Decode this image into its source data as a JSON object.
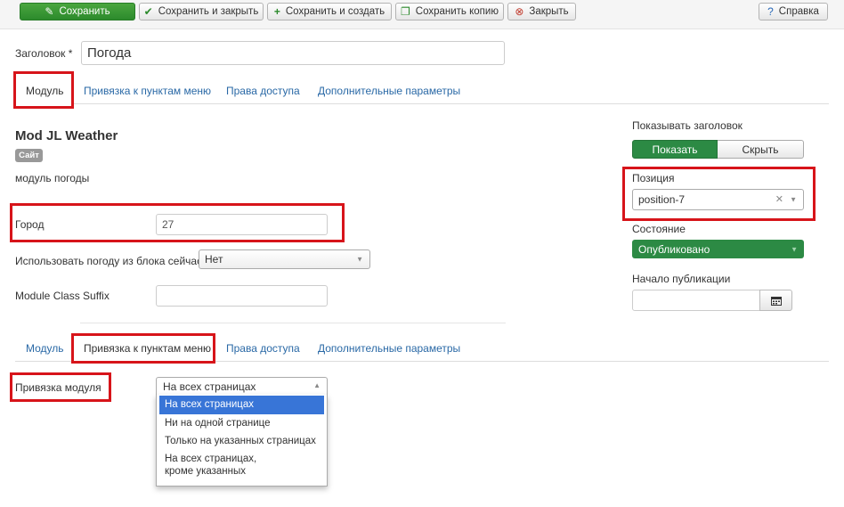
{
  "toolbar": {
    "save": "Сохранить",
    "save_close": "Сохранить и закрыть",
    "save_new": "Сохранить и создать",
    "save_copy": "Сохранить копию",
    "close": "Закрыть",
    "help": "Справка"
  },
  "title_field": {
    "label": "Заголовок *",
    "value": "Погода"
  },
  "tabs": {
    "module": "Модуль",
    "menu_assignment": "Привязка к пунктам меню",
    "permissions": "Права доступа",
    "advanced": "Дополнительные параметры"
  },
  "module": {
    "name": "Mod JL Weather",
    "badge": "Сайт",
    "description": "модуль погоды"
  },
  "fields": {
    "city_label": "Город",
    "city_value": "27",
    "use_weather_label": "Использовать погоду из блока сейчас",
    "use_weather_value": "Нет",
    "suffix_label": "Module Class Suffix",
    "suffix_value": ""
  },
  "right": {
    "show_title_label": "Показывать заголовок",
    "show": "Показать",
    "hide": "Скрыть",
    "position_label": "Позиция",
    "position_value": "position-7",
    "status_label": "Состояние",
    "status_value": "Опубликовано",
    "publish_up_label": "Начало публикации",
    "publish_up_value": ""
  },
  "assignment": {
    "label": "Привязка модуля",
    "selected": "На всех страницах",
    "options": [
      "На всех страницах",
      "Ни на одной странице",
      "Только на указанных страницах",
      "На всех страницах, кроме указанных"
    ]
  },
  "colors": {
    "success": "#2c8a44",
    "highlight": "#d7141a",
    "link": "#2a69a6",
    "selected_option": "#3875d7"
  }
}
